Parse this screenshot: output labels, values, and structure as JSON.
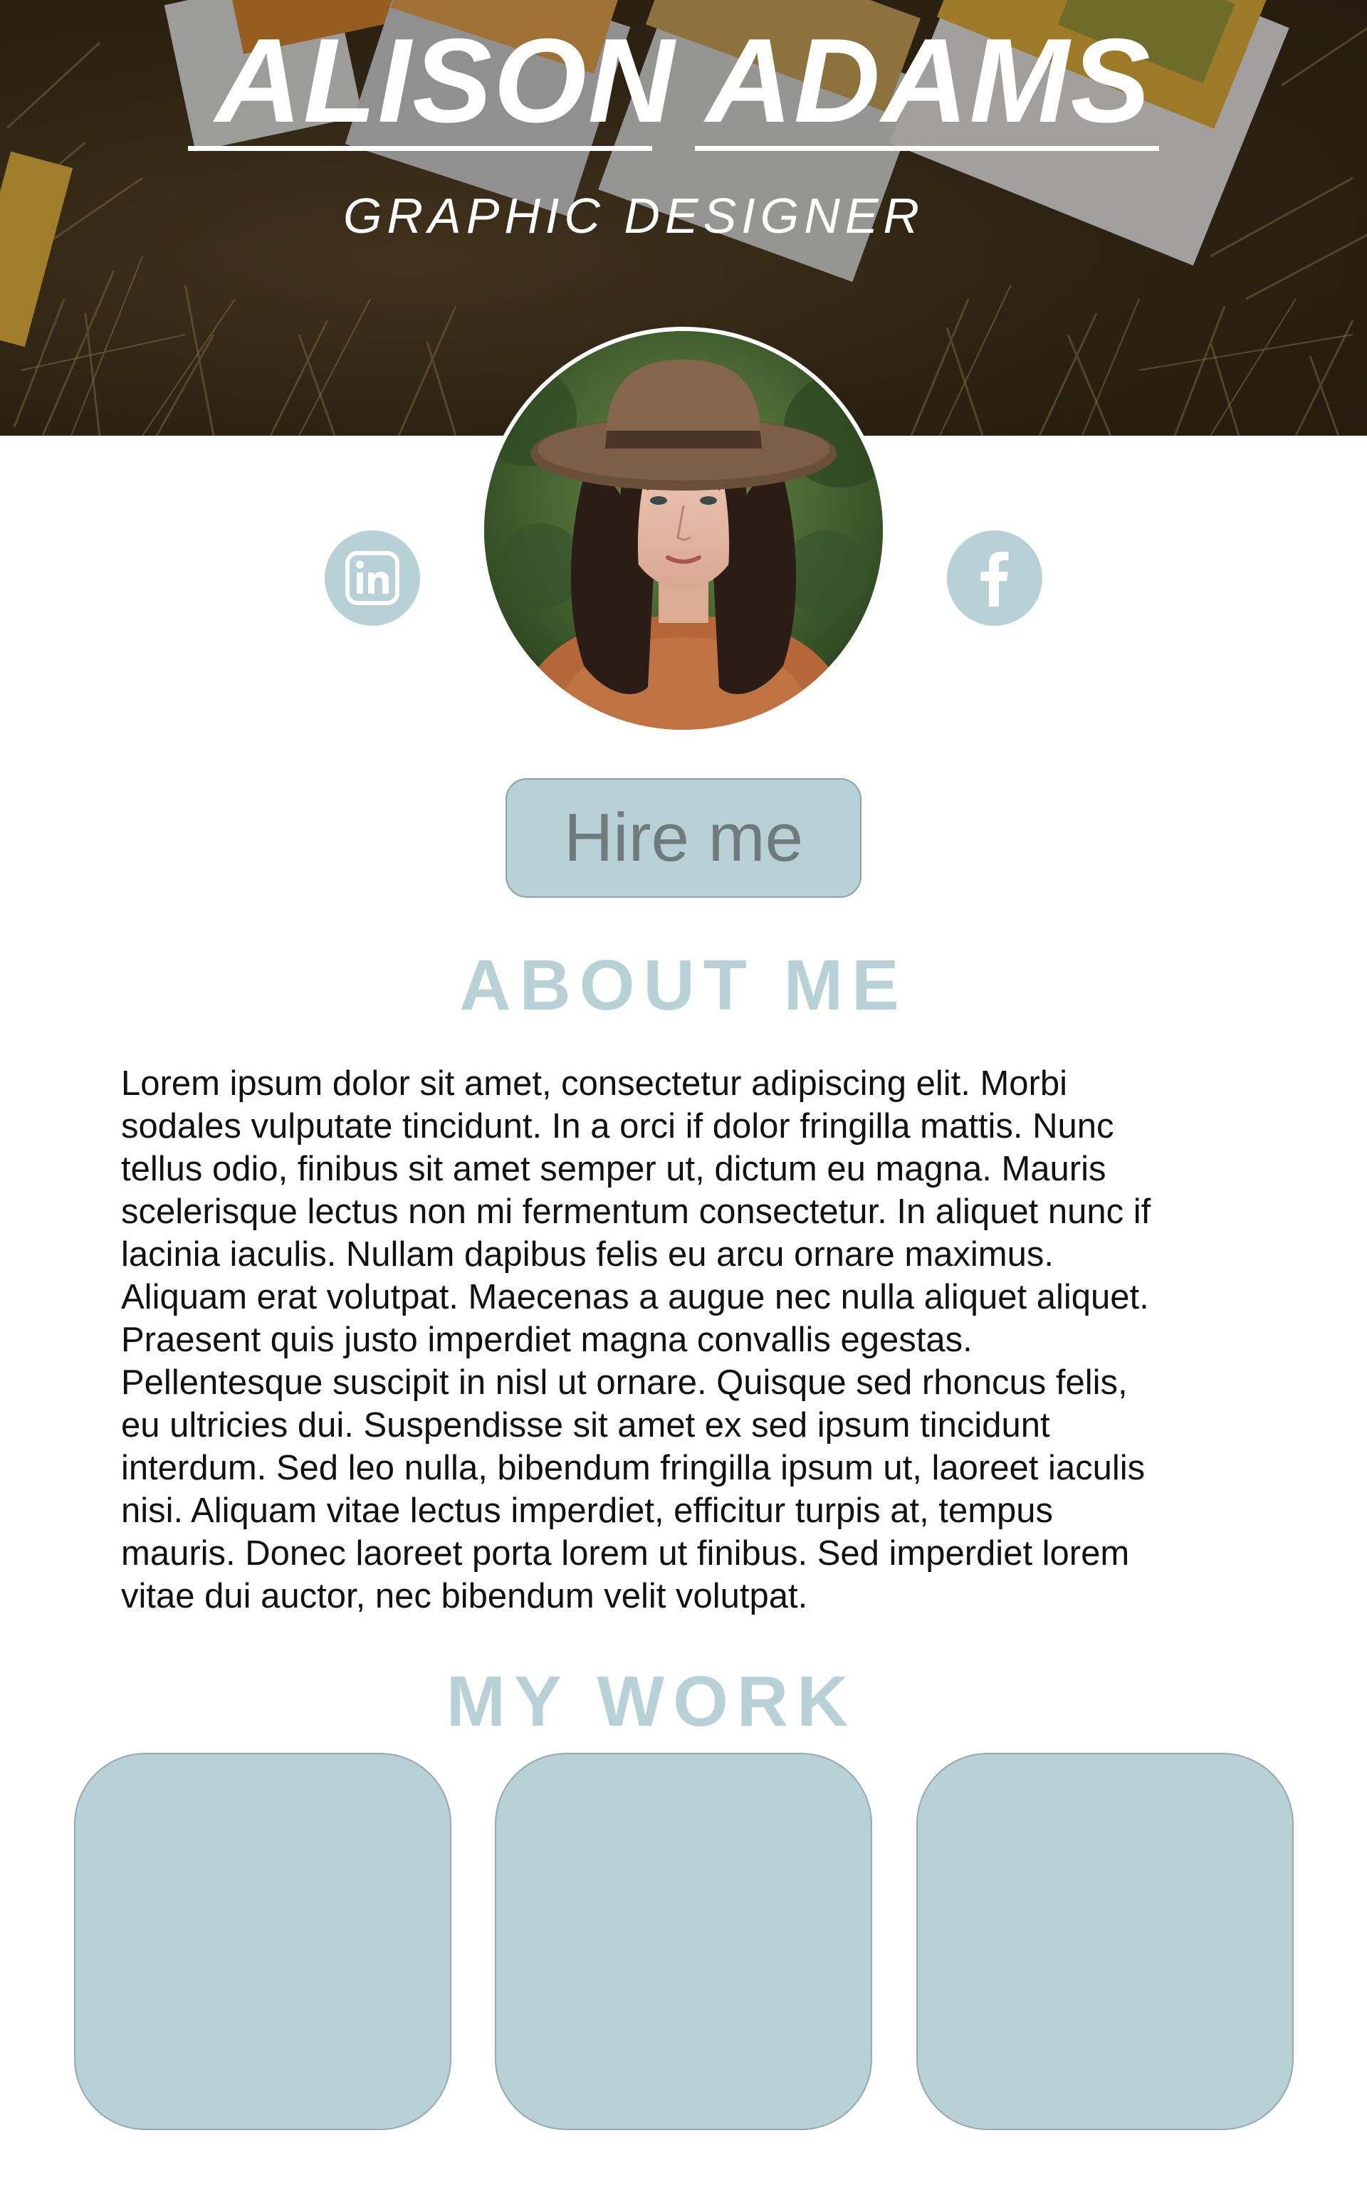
{
  "hero": {
    "title": "ALISON ADAMS",
    "subtitle": "GRAPHIC DESIGNER"
  },
  "profile": {
    "avatar_icon": "portrait-photo"
  },
  "social": {
    "linkedin_icon": "linkedin-icon",
    "facebook_icon": "facebook-icon"
  },
  "cta": {
    "hire_label": "Hire me"
  },
  "about": {
    "heading": "ABOUT ME",
    "lines": [
      "Lorem ipsum dolor sit amet, consectetur adipiscing elit. Morbi",
      "sodales vulputate tincidunt. In a orci if dolor fringilla mattis. Nunc",
      "tellus odio, finibus sit amet semper ut, dictum eu magna. Mauris",
      "scelerisque lectus non mi fermentum consectetur. In aliquet nunc if",
      "lacinia iaculis. Nullam dapibus felis eu arcu ornare maximus.",
      "Aliquam erat volutpat. Maecenas a augue nec nulla aliquet aliquet.",
      "Praesent quis justo imperdiet magna convallis egestas.",
      "Pellentesque suscipit in nisl ut ornare. Quisque sed rhoncus felis,",
      "eu ultricies dui. Suspendisse sit amet ex sed ipsum tincidunt",
      "interdum. Sed leo nulla, bibendum fringilla ipsum ut, laoreet iaculis",
      "nisi. Aliquam vitae lectus imperdiet, efficitur turpis at, tempus",
      "mauris. Donec laoreet porta lorem ut finibus. Sed imperdiet lorem",
      "vitae dui auctor, nec bibendum velit volutpat."
    ]
  },
  "work": {
    "heading": "MY WORK",
    "items": [
      {
        "id": 1
      },
      {
        "id": 2
      },
      {
        "id": 3
      }
    ]
  },
  "colors": {
    "accent": "#b8d1d7",
    "button_text": "#6f7a7d",
    "body_text": "#111111",
    "background": "#ffffff"
  }
}
